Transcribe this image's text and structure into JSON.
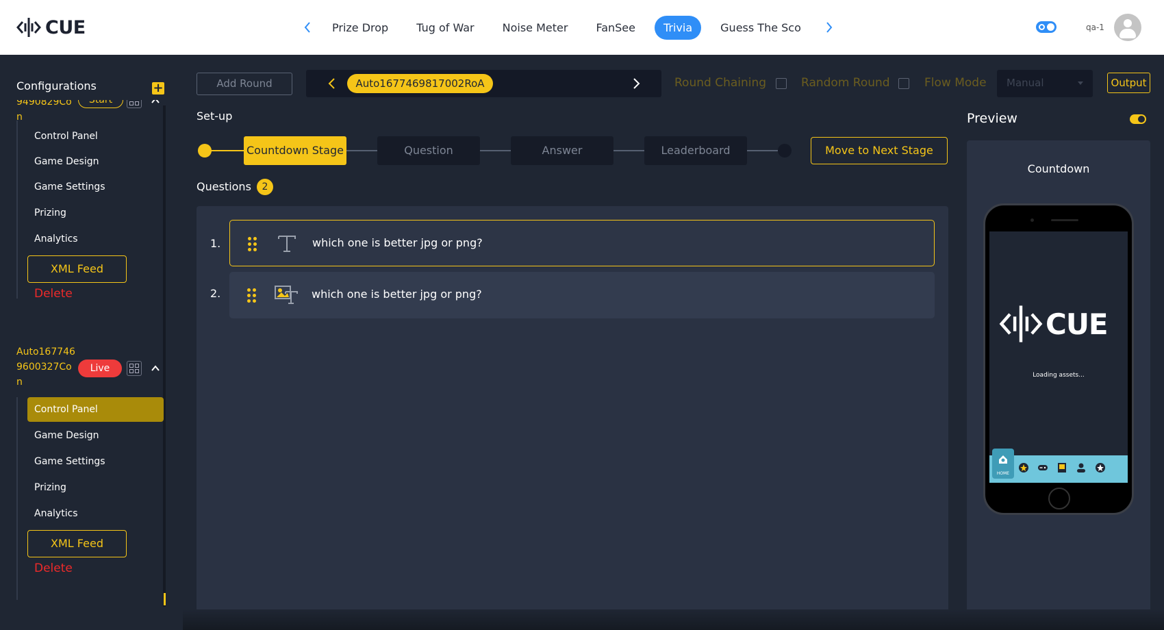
{
  "header": {
    "logo_text": "CUE",
    "tabs": [
      "Prize Drop",
      "Tug of War",
      "Noise Meter",
      "FanSee",
      "Trivia",
      "Guess The Sco"
    ],
    "active_tab": "Trivia",
    "username": "qa-1"
  },
  "sidebar": {
    "title": "Configurations",
    "configs": [
      {
        "name_lines": [
          "9490829Co",
          "n"
        ],
        "status": "Start",
        "items": [
          "Control Panel",
          "Game Design",
          "Game Settings",
          "Prizing",
          "Analytics"
        ],
        "xml_feed": "XML Feed",
        "delete": "Delete"
      },
      {
        "name_lines": [
          "Auto167746",
          "9600327Co",
          "n"
        ],
        "status": "Live",
        "items": [
          "Control Panel",
          "Game Design",
          "Game Settings",
          "Prizing",
          "Analytics"
        ],
        "active_item": "Control Panel",
        "xml_feed": "XML Feed",
        "delete": "Delete"
      }
    ]
  },
  "toolbar": {
    "add_round": "Add Round",
    "round_name": "Auto1677469817002RoA",
    "round_chaining": "Round Chaining",
    "random_round": "Random Round",
    "flow_mode": "Flow Mode",
    "flow_mode_value": "Manual",
    "output": "Output"
  },
  "setup": {
    "label": "Set-up",
    "stages": [
      "Countdown Stage",
      "Question",
      "Answer",
      "Leaderboard"
    ],
    "active_stage": "Countdown Stage",
    "next_stage_button": "Move to Next Stage"
  },
  "questions": {
    "label": "Questions",
    "count": "2",
    "items": [
      {
        "number": "1.",
        "text": "which one is better jpg or png?",
        "type_icon": "text-type-icon",
        "selected": true
      },
      {
        "number": "2.",
        "text": "which one is better jpg or png?",
        "type_icon": "image-text-type-icon",
        "selected": false
      }
    ]
  },
  "preview": {
    "title": "Preview",
    "stage_label": "Countdown",
    "screen_logo": "CUE",
    "loading_text": "Loading assets...",
    "home_label": "HOME"
  },
  "colors": {
    "accent": "#f5c518",
    "primary_blue": "#2f8ef7",
    "live_red": "#ee3b3b",
    "delete_red": "#ee2a2a",
    "bg": "#1f2633"
  }
}
